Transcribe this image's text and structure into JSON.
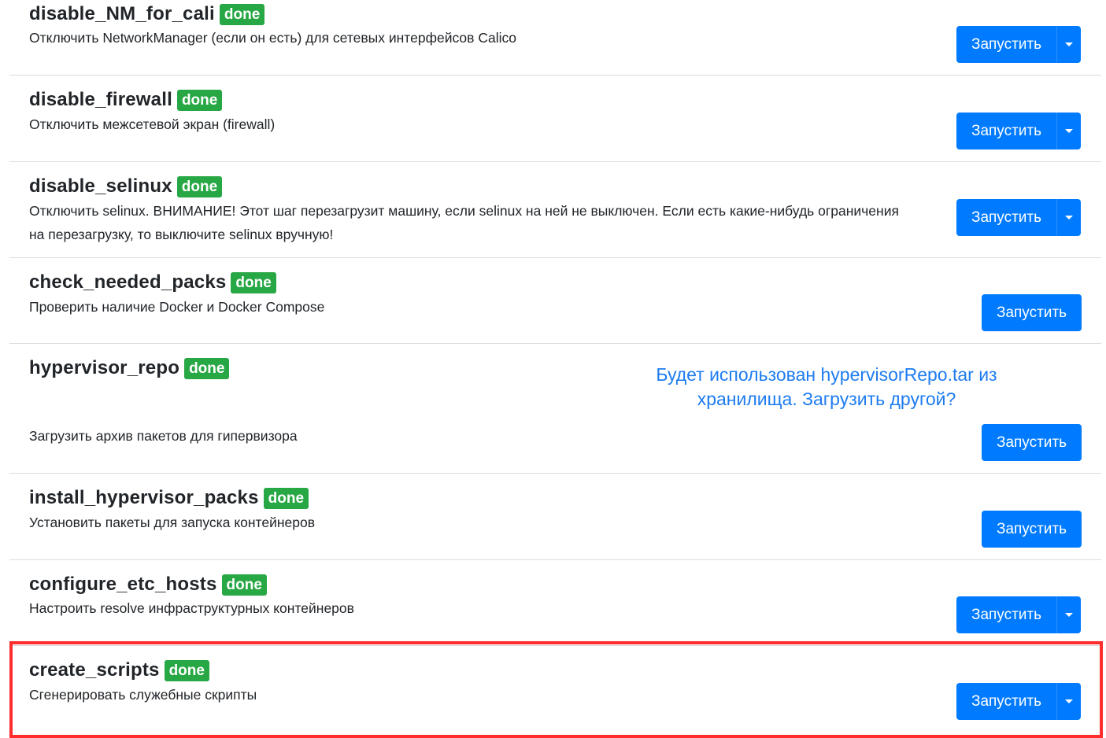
{
  "run_label": "Запустить",
  "badge_label": "done",
  "tasks": [
    {
      "name": "disable_NM_for_cali",
      "status": "done",
      "description": "Отключить NetworkManager (если он есть) для сетевых интерфейсов Calico"
    },
    {
      "name": "disable_firewall",
      "status": "done",
      "description": "Отключить межсетевой экран (firewall)"
    },
    {
      "name": "disable_selinux",
      "status": "done",
      "description": "Отключить selinux. ВНИМАНИЕ! Этот шаг перезагрузит машину, если selinux на ней не выключен. Если есть какие-нибудь ограничения на перезагрузку, то выключите selinux вручную!"
    },
    {
      "name": "check_needed_packs",
      "status": "done",
      "description": "Проверить наличие Docker и Docker Compose"
    },
    {
      "name": "hypervisor_repo",
      "status": "done",
      "description": "Загрузить архив пакетов для гипервизора",
      "info": "Будет использован hypervisorRepo.tar из хранилища. Загрузить другой?"
    },
    {
      "name": "install_hypervisor_packs",
      "status": "done",
      "description": "Установить пакеты для запуска контейнеров"
    },
    {
      "name": "configure_etc_hosts",
      "status": "done",
      "description": "Настроить resolve инфраструктурных контейнеров"
    },
    {
      "name": "create_scripts",
      "status": "done",
      "description": "Сгенерировать служебные скрипты"
    }
  ],
  "colors": {
    "primary": "#007bff",
    "badge": "#28a745",
    "highlight": "#ff2d2d",
    "link": "#1e7cf0"
  }
}
